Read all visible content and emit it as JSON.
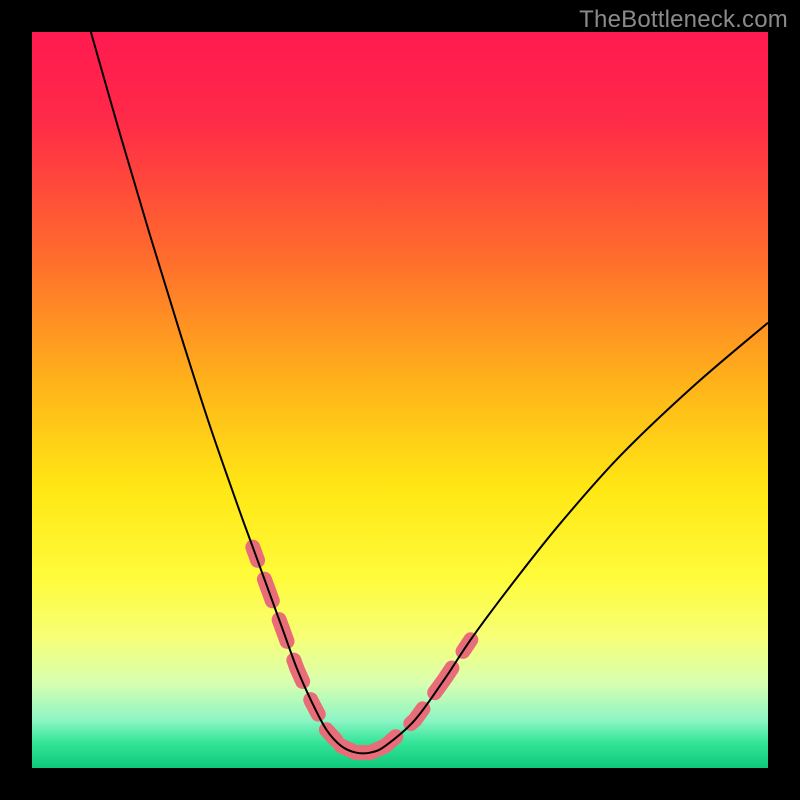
{
  "watermark": "TheBottleneck.com",
  "chart_data": {
    "type": "line",
    "title": "",
    "xlabel": "",
    "ylabel": "",
    "xlim": [
      0,
      100
    ],
    "ylim": [
      0,
      100
    ],
    "gradient_stops": [
      {
        "offset": 0.0,
        "color": "#ff1a50"
      },
      {
        "offset": 0.12,
        "color": "#ff2a48"
      },
      {
        "offset": 0.3,
        "color": "#ff6a2d"
      },
      {
        "offset": 0.48,
        "color": "#ffb41a"
      },
      {
        "offset": 0.62,
        "color": "#ffe714"
      },
      {
        "offset": 0.74,
        "color": "#fffb3a"
      },
      {
        "offset": 0.82,
        "color": "#f7ff74"
      },
      {
        "offset": 0.885,
        "color": "#d8ffb0"
      },
      {
        "offset": 0.935,
        "color": "#8cf5c4"
      },
      {
        "offset": 0.965,
        "color": "#35e598"
      },
      {
        "offset": 1.0,
        "color": "#0ec97a"
      }
    ],
    "series": [
      {
        "name": "bottleneck-curve",
        "x": [
          8.0,
          12.0,
          16.0,
          20.0,
          24.0,
          28.0,
          30.0,
          32.0,
          34.0,
          36.0,
          38.0,
          40.0,
          42.0,
          44.0,
          46.0,
          48.0,
          52.0,
          56.0,
          60.0,
          66.0,
          72.0,
          80.0,
          90.0,
          100.0
        ],
        "y": [
          100.0,
          86.0,
          72.5,
          59.5,
          47.0,
          35.5,
          30.0,
          24.5,
          19.0,
          13.5,
          9.0,
          5.2,
          3.0,
          2.1,
          2.1,
          3.0,
          6.5,
          12.0,
          18.0,
          26.0,
          33.5,
          42.5,
          52.0,
          60.5
        ]
      }
    ],
    "highlight_segments": [
      {
        "x0": 30.0,
        "y0": 30.0,
        "x1": 32.0,
        "y1": 24.5
      },
      {
        "x0": 32.0,
        "y0": 24.5,
        "x1": 34.0,
        "y1": 19.0
      },
      {
        "x0": 34.0,
        "y0": 19.0,
        "x1": 36.0,
        "y1": 13.5
      },
      {
        "x0": 36.0,
        "y0": 13.5,
        "x1": 38.0,
        "y1": 9.0
      },
      {
        "x0": 38.0,
        "y0": 9.0,
        "x1": 40.0,
        "y1": 5.2
      },
      {
        "x0": 40.0,
        "y0": 5.2,
        "x1": 42.0,
        "y1": 3.0
      },
      {
        "x0": 42.0,
        "y0": 3.0,
        "x1": 44.0,
        "y1": 2.1
      },
      {
        "x0": 44.0,
        "y0": 2.1,
        "x1": 46.0,
        "y1": 2.1
      },
      {
        "x0": 46.0,
        "y0": 2.1,
        "x1": 48.0,
        "y1": 3.0
      },
      {
        "x0": 48.0,
        "y0": 3.0,
        "x1": 52.0,
        "y1": 6.5
      },
      {
        "x0": 52.0,
        "y0": 6.5,
        "x1": 56.0,
        "y1": 12.0
      },
      {
        "x0": 56.0,
        "y0": 12.0,
        "x1": 60.0,
        "y1": 18.0
      }
    ],
    "highlight_color": "#e86d78",
    "curve_color": "#000000"
  }
}
